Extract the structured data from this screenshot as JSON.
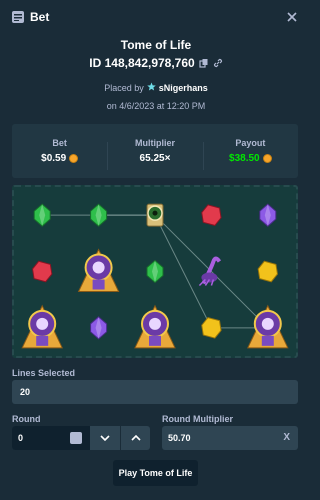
{
  "header": {
    "title": "Bet",
    "icon": "bet-ticket-icon",
    "close_icon": "close-icon"
  },
  "game": {
    "title": "Tome of Life"
  },
  "bet": {
    "id": "ID 148,842,978,760",
    "copy_icon": "copy-icon",
    "link_icon": "link-icon"
  },
  "placed": {
    "prefix": "Placed by",
    "user": "sNigerhans",
    "user_icon": "vip-star-icon",
    "date": "on 4/6/2023 at 12:20 PM"
  },
  "stats": {
    "bet_label": "Bet",
    "bet_value": "$0.59",
    "multiplier_label": "Multiplier",
    "multiplier_value": "65.25×",
    "payout_label": "Payout",
    "payout_value": "$38.50",
    "coin_icon": "coin-icon"
  },
  "board": {
    "rows": 3,
    "cols": 5,
    "symbols": [
      [
        "green-gem",
        "green-gem",
        "eye-idol",
        "red-gem",
        "purple-gem"
      ],
      [
        "red-gem",
        "pharaoh",
        "green-gem",
        "scorpion",
        "yellow-gem"
      ],
      [
        "pharaoh",
        "purple-gem",
        "pharaoh",
        "yellow-gem",
        "pharaoh"
      ]
    ]
  },
  "lines": {
    "label": "Lines Selected",
    "value": "20"
  },
  "round": {
    "label": "Round",
    "value": "0",
    "down_icon": "chevron-down-icon",
    "up_icon": "chevron-up-icon"
  },
  "round_multiplier": {
    "label": "Round Multiplier",
    "value": "50.70",
    "clear_label": "X"
  },
  "play": {
    "label": "Play Tome of Life"
  },
  "colors": {
    "background": "#1a2c38",
    "panel": "#213743",
    "input": "#2f4553",
    "payout_green": "#00e701",
    "board_bg": "#163c3c"
  }
}
